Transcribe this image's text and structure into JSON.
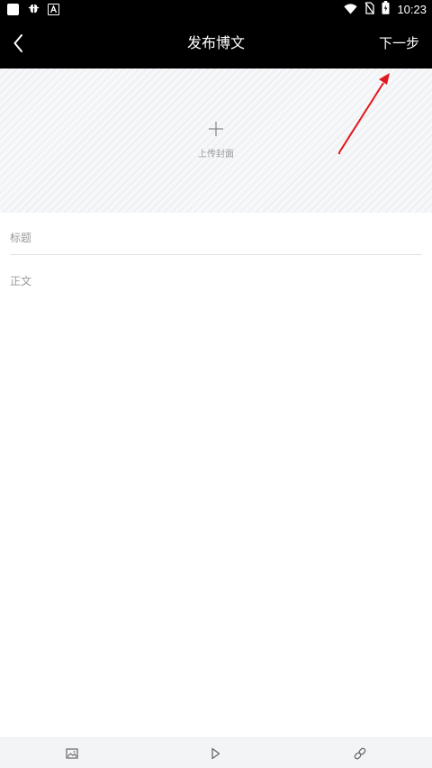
{
  "status_bar": {
    "time": "10:23",
    "icons": [
      "app-square-icon",
      "bug-icon",
      "font-a-icon",
      "wifi-icon",
      "no-sim-icon",
      "battery-icon"
    ]
  },
  "header": {
    "title": "发布博文",
    "next_label": "下一步",
    "back_icon": "chevron-left-icon"
  },
  "cover": {
    "upload_label": "上传封面",
    "icon": "plus-icon"
  },
  "editor": {
    "title_placeholder": "标题",
    "title_value": "",
    "body_placeholder": "正文",
    "body_value": ""
  },
  "toolbar": {
    "items": [
      "image-icon",
      "play-icon",
      "link-icon"
    ]
  },
  "colors": {
    "header_bg": "#000000",
    "annotation_arrow": "#e0191c",
    "placeholder_text": "#9a9a9a",
    "toolbar_bg": "#f3f4f6"
  }
}
